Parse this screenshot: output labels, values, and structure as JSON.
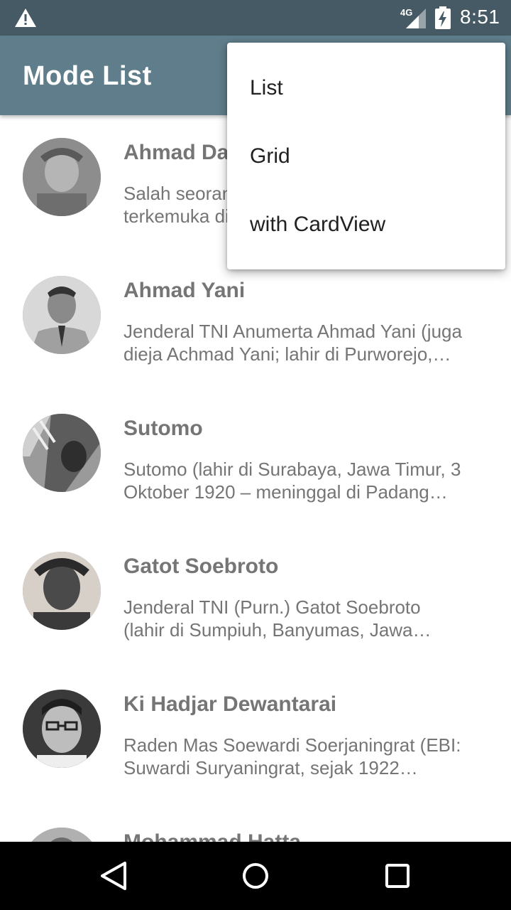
{
  "status_bar": {
    "time": "8:51",
    "network": "4G",
    "icons": [
      "warning-icon",
      "signal-icon",
      "battery-charging-icon"
    ]
  },
  "app_bar": {
    "title": "Mode List"
  },
  "menu": {
    "items": [
      {
        "label": "List"
      },
      {
        "label": "Grid"
      },
      {
        "label": "with CardView"
      }
    ]
  },
  "list": {
    "items": [
      {
        "name": "Ahmad Dahlan",
        "desc_line1": "Salah seorang ulama dan pahlawan",
        "desc_line2": "terkemuka di Indonesia…"
      },
      {
        "name": "Ahmad Yani",
        "desc_line1": "Jenderal TNI Anumerta Ahmad Yani (juga",
        "desc_line2": "dieja Achmad Yani; lahir di Purworejo,…"
      },
      {
        "name": "Sutomo",
        "desc_line1": "Sutomo (lahir di Surabaya, Jawa Timur, 3",
        "desc_line2": "Oktober 1920 – meninggal di Padang…"
      },
      {
        "name": "Gatot Soebroto",
        "desc_line1": "Jenderal TNI (Purn.) Gatot Soebroto",
        "desc_line2": "(lahir di Sumpiuh, Banyumas, Jawa…"
      },
      {
        "name": "Ki Hadjar Dewantarai",
        "desc_line1": "Raden Mas Soewardi Soerjaningrat (EBI:",
        "desc_line2": "Suwardi Suryaningrat, sejak 1922…"
      },
      {
        "name": "Mohammad Hatta",
        "desc_line1": "",
        "desc_line2": ""
      }
    ]
  },
  "nav_bar": {
    "buttons": [
      "back-icon",
      "home-icon",
      "recents-icon"
    ]
  },
  "colors": {
    "status_bar": "#455a64",
    "app_bar": "#607d8b",
    "text_secondary": "#757575"
  }
}
